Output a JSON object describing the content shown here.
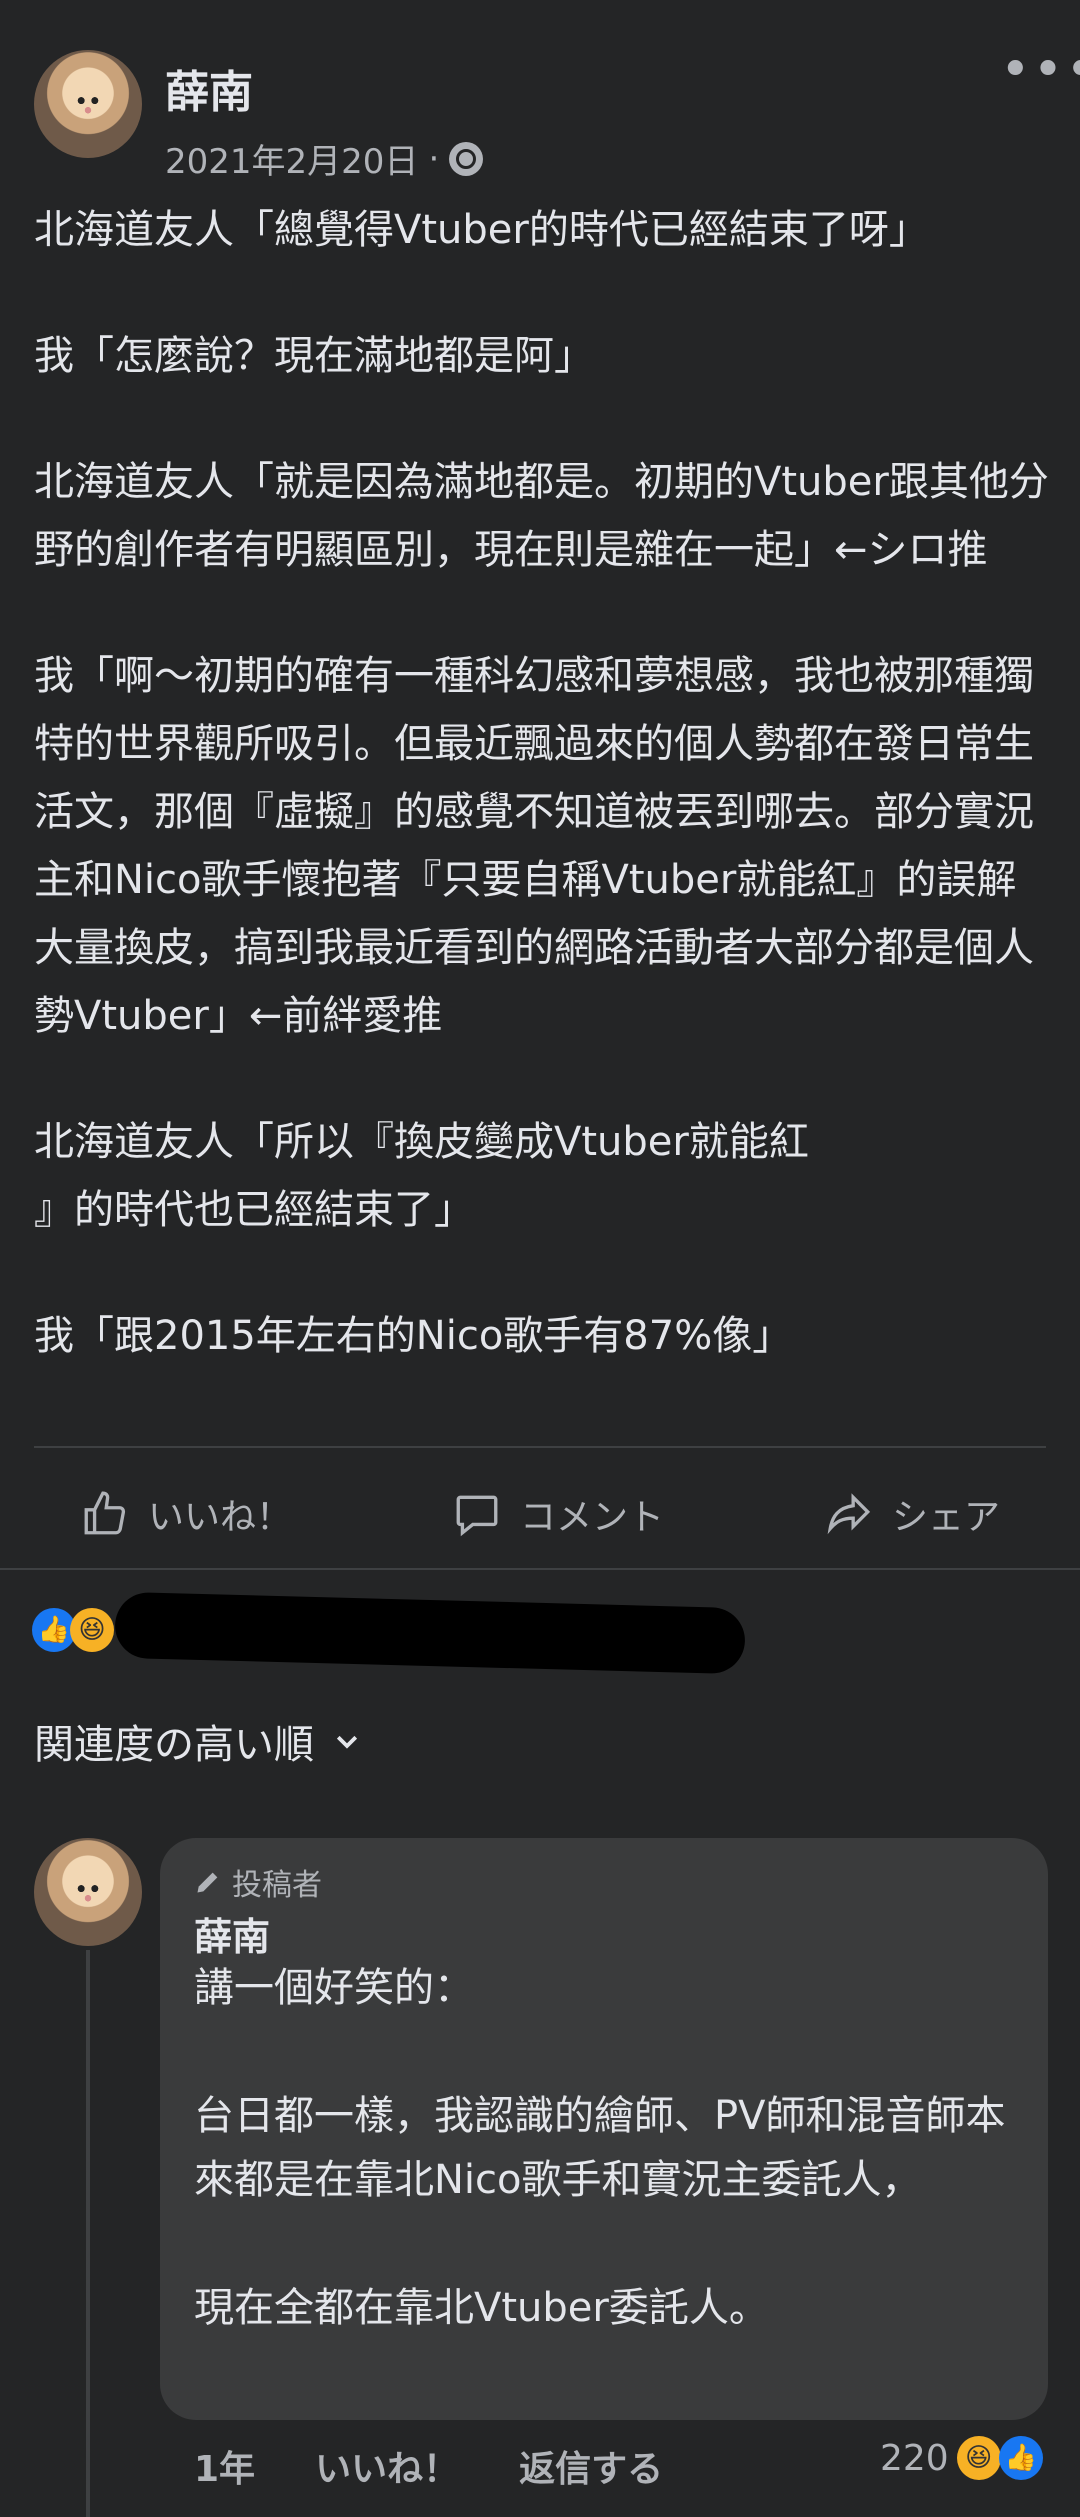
{
  "post": {
    "author": "薛南",
    "date": "2021年2月20日",
    "privacy_separator": "·",
    "paragraphs": [
      "北海道友人「總覺得Vtuber的時代已經結束了呀」",
      "我「怎麼說？現在滿地都是阿」",
      "北海道友人「就是因為滿地都是。初期的Vtuber跟其他分野的創作者有明顯區別，現在則是雜在一起」←シロ推",
      "我「啊～初期的確有一種科幻感和夢想感，我也被那種獨特的世界觀所吸引。但最近飄過來的個人勢都在發日常生活文，那個『虛擬』的感覺不知道被丟到哪去。部分實況主和Nico歌手懷抱著『只要自稱Vtuber就能紅』的誤解大量換皮，搞到我最近看到的網路活動者大部分都是個人勢Vtuber」←前絆愛推",
      "北海道友人「所以『換皮變成Vtuber就能紅\n』的時代也已經結束了」",
      "我「跟2015年左右的Nico歌手有87%像」"
    ]
  },
  "actions": {
    "like": "いいね！",
    "comment": "コメント",
    "share": "シェア"
  },
  "icons": {
    "more": "more-options-icon",
    "globe": "globe-icon",
    "like": "thumbs-up-icon",
    "comment": "speech-bubble-icon",
    "share": "share-arrow-icon",
    "chevron": "chevron-down-icon",
    "pencil": "pencil-icon"
  },
  "sort_label": "関連度の高い順",
  "comment": {
    "badge": "投稿者",
    "author": "薛南",
    "paragraphs": [
      "講一個好笑的：",
      "台日都一樣，我認識的繪師、PV師和混音師本來都是在靠北Nico歌手和實況主委託人，",
      "現在全都在靠北Vtuber委託人。"
    ],
    "time": "1年",
    "like": "いいね！",
    "reply": "返信する",
    "reaction_count": "220"
  },
  "colors": {
    "background": "#242526",
    "bubble": "#3a3b3c",
    "text": "#e4e6eb",
    "secondary": "#b0b3b8",
    "like_blue": "#1877f2",
    "haha_yellow": "#f7b125"
  }
}
